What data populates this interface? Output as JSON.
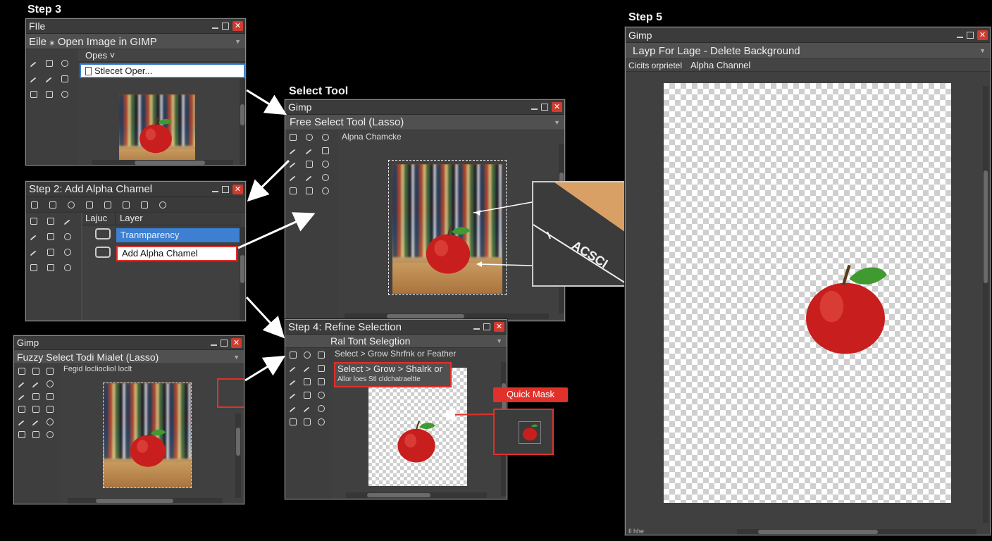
{
  "steps": {
    "step3": "Step 3",
    "step2": "Step 2: Add Alpha Chamel",
    "select_tool": "Select Tool",
    "step4": "Step 4: Refine Selection",
    "step5": "Step 5"
  },
  "win_open": {
    "title": "FIle",
    "menu": "Eile  ⁎  Open Image in GIMP",
    "tab": "Opes ˅",
    "popup": "Stlecet Oper..."
  },
  "win_alpha": {
    "layers_col1": "Lajuc",
    "layers_col2": "Layer",
    "row1": "Tranmparency",
    "row2": "Add Alpha Chamel"
  },
  "win_fuzzy": {
    "title": "Gimp",
    "menu": "Fuzzy Select Todi Mialet (Lasso)",
    "sub": "Fegid locliocliol loclt"
  },
  "win_free": {
    "title": "Gimp",
    "menu": "Free Select Tool (Lasso)",
    "sub": "Alpna Chamcke",
    "zoom_text": "ACSCI"
  },
  "win_refine": {
    "menu": "Ral Tont Selegtion",
    "sub": "Select > Grow Shrfnk or Feather",
    "box_line1": "Select > Grow > Shalrk  or",
    "box_line2": "Allor loes Stl cldchatraeltte",
    "quick_mask": "Quick Mask"
  },
  "win_final": {
    "title": "Gimp",
    "menu": "Layp  For  Lage - Delete Background",
    "sub_left": "Cicits orprietel",
    "sub_right": "Alpha Channel",
    "status": "Il hhe"
  },
  "colors": {
    "accent_red": "#e0312a",
    "selection_blue": "#3d7fd1",
    "window_bg": "#4a4a4a"
  }
}
